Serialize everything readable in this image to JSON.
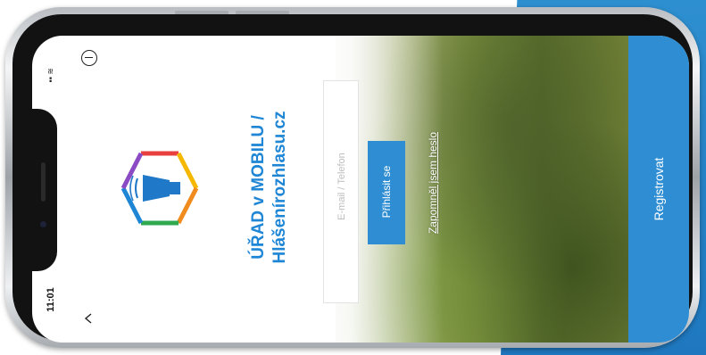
{
  "status_bar": {
    "time": "11:01",
    "signal_glyph": "▪▪ ≋"
  },
  "app": {
    "title_line1": "ÚŘAD v MOBILU /",
    "title_line2": "Hlášenírozhlasu.cz",
    "login_field_placeholder": "E-mail / Telefon",
    "login_button": "Přihlásit se",
    "forgot_password_link": "Zapomněl jsem heslo",
    "register_button": "Registrovat"
  },
  "icons": {
    "menu": "minus-circle-icon",
    "back": "chevron-down-icon",
    "logo": "loudspeaker-hexagon-logo"
  },
  "colors": {
    "accent": "#2f8ed3",
    "title": "#1f86d6"
  }
}
